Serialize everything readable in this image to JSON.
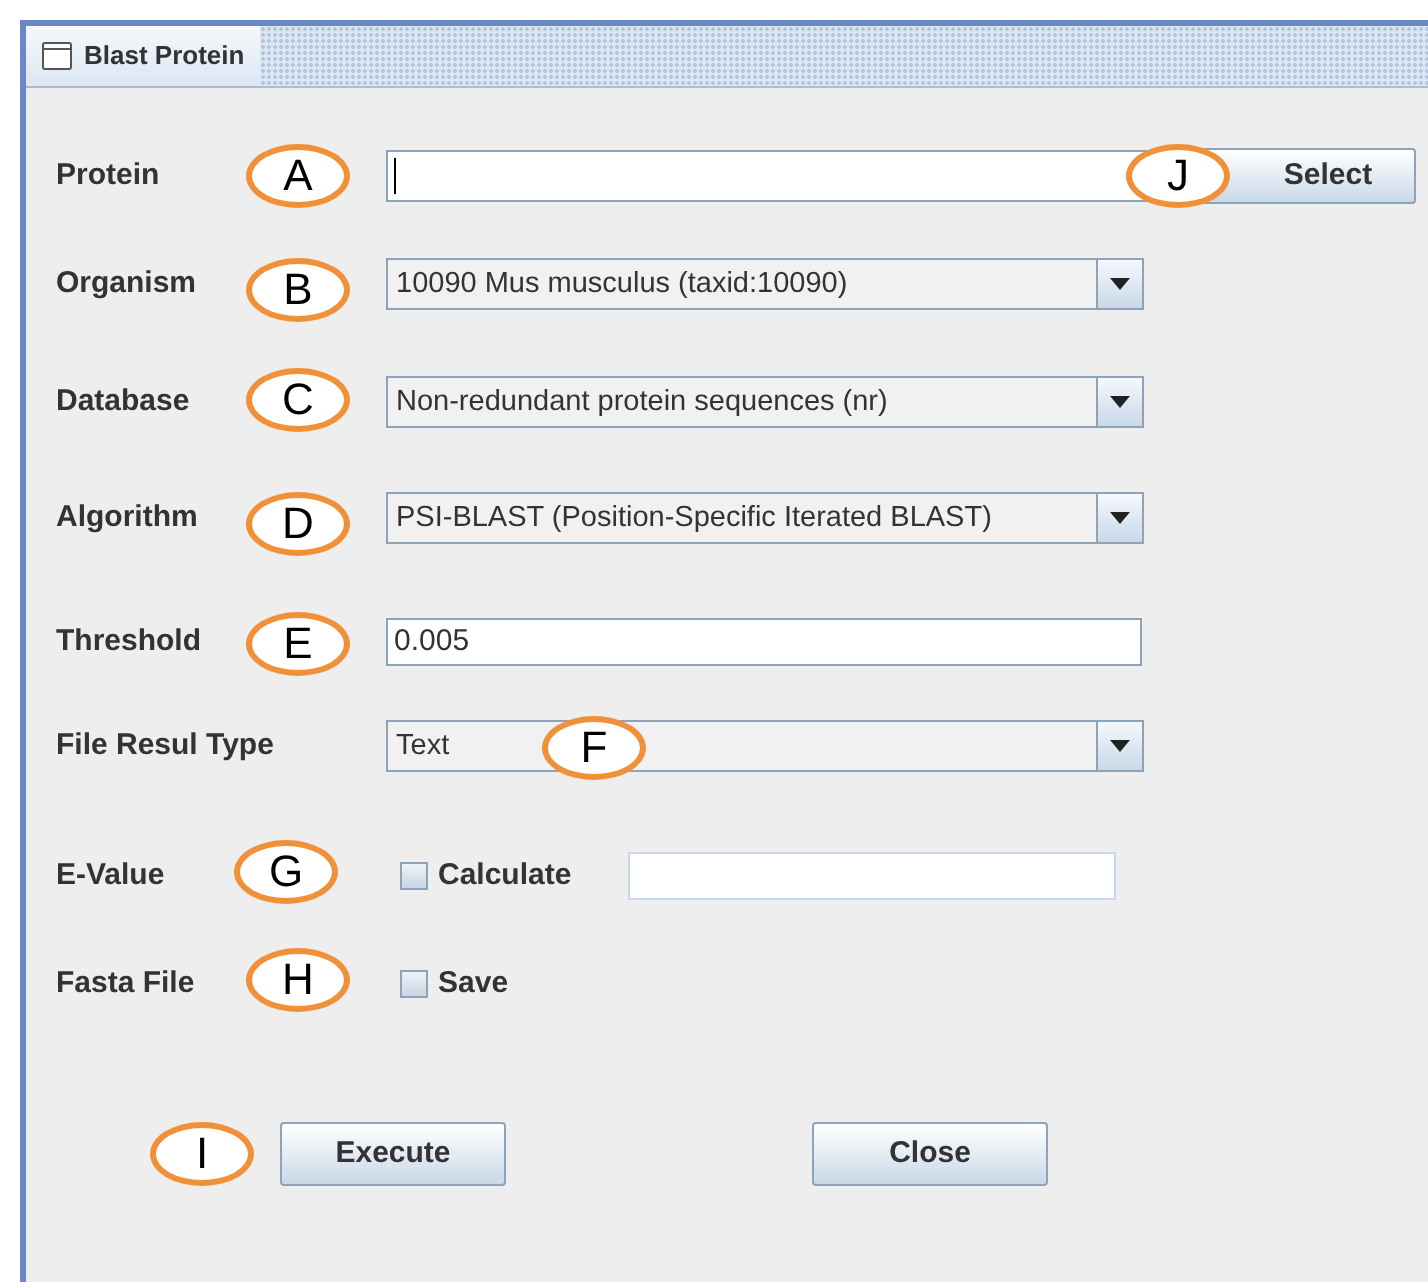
{
  "window": {
    "title": "Blast Protein"
  },
  "rows": [
    {
      "kind": "text_button",
      "label": "Protein",
      "callout": "A",
      "button": {
        "label": "Select",
        "callout": "J"
      }
    },
    {
      "kind": "combo",
      "label": "Organism",
      "callout": "B",
      "value": "10090 Mus musculus (taxid:10090)"
    },
    {
      "kind": "combo",
      "label": "Database",
      "callout": "C",
      "value": "Non-redundant protein sequences (nr)"
    },
    {
      "kind": "combo",
      "label": "Algorithm",
      "callout": "D",
      "value": "PSI-BLAST (Position-Specific Iterated BLAST)"
    },
    {
      "kind": "text",
      "label": "Threshold",
      "callout": "E",
      "value": "0.005"
    },
    {
      "kind": "combo",
      "label": "File Resul Type",
      "callout": "F",
      "value": "Text"
    },
    {
      "kind": "checkbox_field",
      "label": "E-Value",
      "callout": "G",
      "checkbox": {
        "label": "Calculate",
        "checked": false
      }
    },
    {
      "kind": "checkbox",
      "label": "Fasta File",
      "callout": "H",
      "checkbox": {
        "label": "Save",
        "checked": false
      }
    }
  ],
  "buttons": [
    {
      "label": "Execute",
      "callout": "I"
    },
    {
      "label": "Close"
    }
  ]
}
